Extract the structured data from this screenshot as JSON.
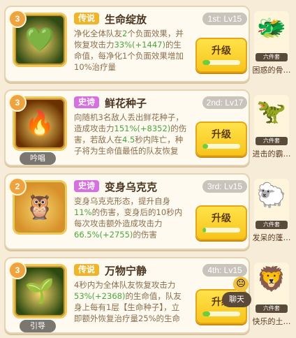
{
  "skills": [
    {
      "level": "3",
      "rarity": "传说",
      "rarity_color": "#f0b429",
      "name": "生命绽放",
      "rank": "1st: Lv15",
      "icon": "heart-flower-icon",
      "icon_glyph": "💚",
      "icon_bg": "#2f4a12",
      "tag": "",
      "desc": [
        {
          "t": "净化全体队友"
        },
        {
          "t": "2",
          "hl": true
        },
        {
          "t": "个负面效果，并恢复攻击力"
        },
        {
          "t": "33%(+1447)",
          "hl": true
        },
        {
          "t": "的生命值，每净化1个负面效果增加10%治疗量"
        }
      ],
      "button": "升级",
      "progress": 0.2
    },
    {
      "level": "3",
      "rarity": "史诗",
      "rarity_color": "#d86fe0",
      "name": "鲜花种子",
      "rank": "2nd: Lv17",
      "icon": "flame-seed-icon",
      "icon_glyph": "🔥",
      "icon_bg": "#6a3000",
      "tag": "吟唱",
      "desc": [
        {
          "t": "向随机3名敌人丢出鲜花种子，造成攻击力"
        },
        {
          "t": "151%(+8352)",
          "hl": true
        },
        {
          "t": "的伤害，若敌人在"
        },
        {
          "t": "4.5",
          "hl": true
        },
        {
          "t": "秒内阵亡，种子将为生命值最低的队友恢复攻…"
        }
      ],
      "button": "升级",
      "progress": 0.15
    },
    {
      "level": "2",
      "rarity": "史诗",
      "rarity_color": "#d86fe0",
      "name": "变身乌克克",
      "rank": "3rd: Lv15",
      "icon": "owl-transform-icon",
      "icon_glyph": "🦉",
      "icon_bg": "#d8902a",
      "tag": "",
      "desc": [
        {
          "t": "变身乌克克形态，提升自身"
        },
        {
          "t": "11%",
          "hl": true
        },
        {
          "t": "的伤害，变身后的10秒内每次攻击额外造成攻击力"
        },
        {
          "t": "66.5%(+2755)",
          "hl": true
        },
        {
          "t": "的伤害"
        }
      ],
      "button": "升级",
      "progress": 0.1
    },
    {
      "level": "3",
      "rarity": "传说",
      "rarity_color": "#f0b429",
      "name": "万物宁静",
      "rank": "4th: Lv15",
      "icon": "sprout-icon",
      "icon_glyph": "🌱",
      "icon_bg": "#2c4a10",
      "tag": "引导",
      "desc": [
        {
          "t": "4秒内为全体队友恢复攻击力"
        },
        {
          "t": "53%(+2368)",
          "hl": true
        },
        {
          "t": "的生命值，队友身上每有1层【生命种子】，立即额外恢复治疗量25%的生命值"
        }
      ],
      "button": "升级",
      "progress": 0.2
    }
  ],
  "companions": [
    {
      "name": "困惑的骨…",
      "caption": "六件套",
      "glyph": "🐲",
      "icon": "confused-dragon-icon"
    },
    {
      "name": "进击的霸…",
      "caption": "六件套",
      "glyph": "🦖",
      "icon": "red-dino-icon"
    },
    {
      "name": "发呆的蓬…",
      "caption": "六件套",
      "glyph": "🐑",
      "icon": "fluffy-creature-icon"
    },
    {
      "name": "快乐的土…",
      "caption": "六件套",
      "glyph": "🦁",
      "icon": "lion-icon"
    }
  ],
  "chat": {
    "label": "聊天",
    "icon": "chat-face-icon",
    "glyph": "😐"
  }
}
